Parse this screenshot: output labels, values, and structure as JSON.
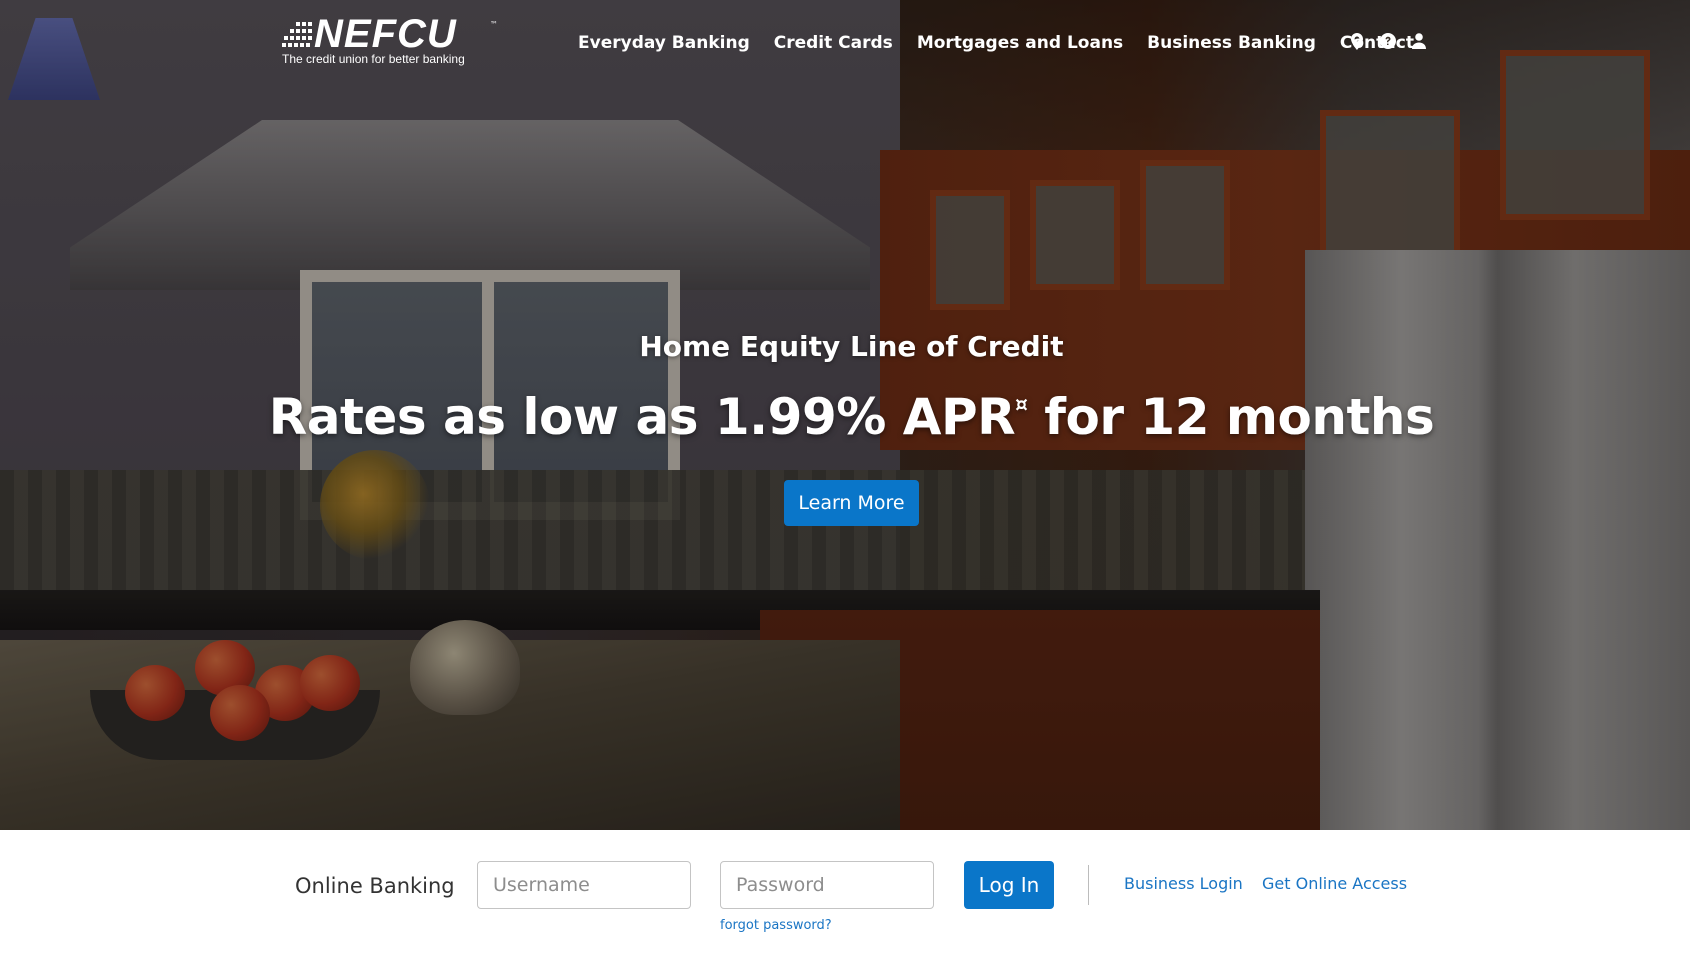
{
  "header": {
    "logo_text": "NEFCU",
    "logo_tagline": "The credit union for better banking",
    "logo_tm": "™",
    "nav": [
      {
        "label": "Everyday Banking"
      },
      {
        "label": "Credit Cards"
      },
      {
        "label": "Mortgages and Loans"
      },
      {
        "label": "Business Banking"
      },
      {
        "label": "Contact"
      }
    ],
    "icons": [
      "map-marker-icon",
      "help-circle-icon",
      "user-icon"
    ]
  },
  "hero": {
    "subtitle": "Home Equity Line of Credit",
    "title": "Rates as low as 1.99% APR",
    "title_mark": "¤",
    "title_suffix": " for 12 months",
    "button_label": "Learn More"
  },
  "login": {
    "label": "Online Banking",
    "username_placeholder": "Username",
    "password_placeholder": "Password",
    "button_label": "Log In",
    "forgot_label": "forgot password?",
    "business_login": "Business Login",
    "get_access": "Get Online Access"
  },
  "colors": {
    "accent": "#0a76c9",
    "link": "#1a75c4",
    "nav_text": "#ffffff"
  }
}
